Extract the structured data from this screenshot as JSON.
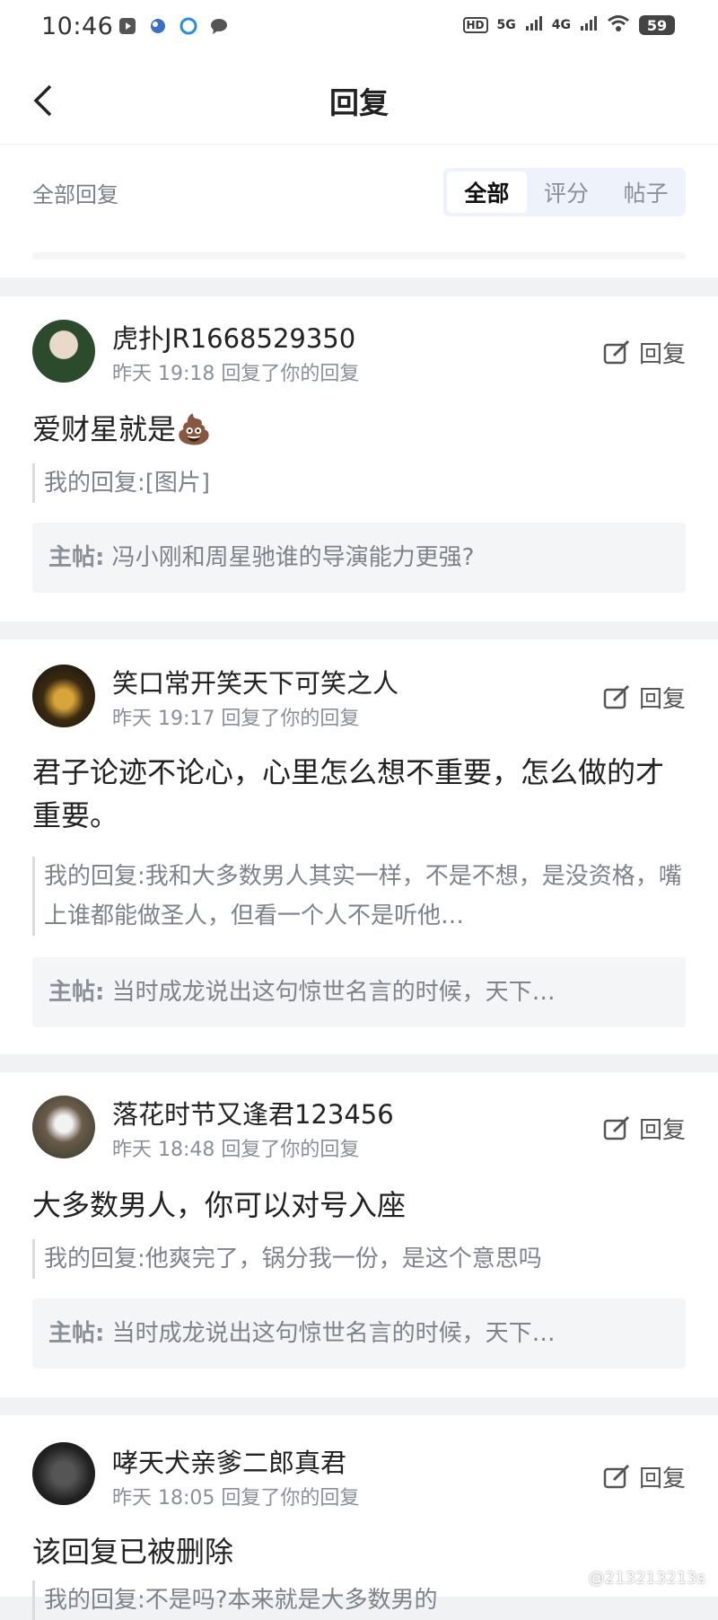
{
  "status": {
    "time": "10:46",
    "signal_5g": "5G",
    "signal_4g": "4G",
    "hd": "HD",
    "battery": "59"
  },
  "nav": {
    "title": "回复"
  },
  "filter": {
    "label": "全部回复",
    "tabs": [
      "全部",
      "评分",
      "帖子"
    ],
    "active_tab": "全部"
  },
  "replies": [
    {
      "username": "虎扑JR1668529350",
      "time": "昨天 19:18",
      "action": "回复了你的回复",
      "reply_label": "回复",
      "content": "爱财星就是💩",
      "my_reply": "我的回复:[图片]",
      "main_post_label": "主帖:",
      "main_post": "冯小刚和周星驰谁的导演能力更强?"
    },
    {
      "username": "笑口常开笑天下可笑之人",
      "time": "昨天 19:17",
      "action": "回复了你的回复",
      "reply_label": "回复",
      "content": "君子论迹不论心，心里怎么想不重要，怎么做的才重要。",
      "my_reply": "我的回复:我和大多数男人其实一样，不是不想，是没资格，嘴上谁都能做圣人，但看一个人不是听他…",
      "main_post_label": "主帖:",
      "main_post": "当时成龙说出这句惊世名言的时候，天下…"
    },
    {
      "username": "落花时节又逢君123456",
      "time": "昨天 18:48",
      "action": "回复了你的回复",
      "reply_label": "回复",
      "content": "大多数男人，你可以对号入座",
      "my_reply": "我的回复:他爽完了，锅分我一份，是这个意思吗",
      "main_post_label": "主帖:",
      "main_post": "当时成龙说出这句惊世名言的时候，天下…"
    },
    {
      "username": "哮天犬亲爹二郎真君",
      "time": "昨天 18:05",
      "action": "回复了你的回复",
      "reply_label": "回复",
      "content": "该回复已被删除",
      "my_reply": "我的回复:不是吗?本来就是大多数男的"
    }
  ],
  "watermark": "@213213213s",
  "colors": {
    "accent": "#eef3fb",
    "text": "#222222",
    "muted": "#8a8f98"
  }
}
